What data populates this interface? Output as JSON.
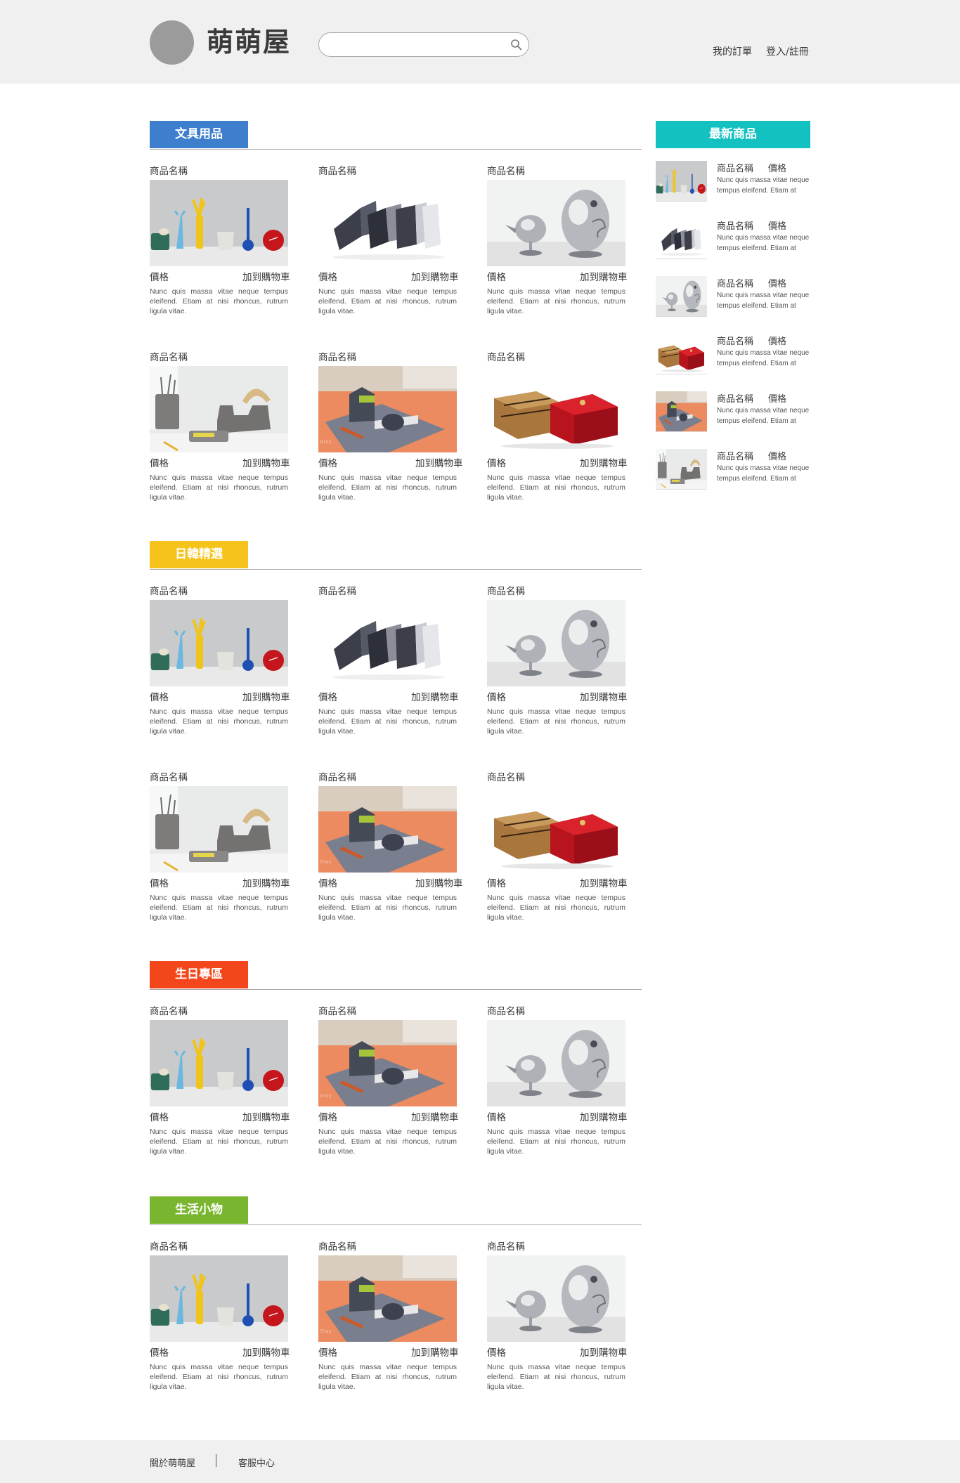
{
  "header": {
    "site_name": "萌萌屋",
    "search_placeholder": "",
    "nav": {
      "orders": "我的訂單",
      "login": "登入/註冊"
    }
  },
  "colors": {
    "stationery": "#3d7fcc",
    "japan_korea": "#f5c31c",
    "birthday": "#f4461b",
    "life": "#79b52f",
    "newest": "#13c1c1"
  },
  "product_template": {
    "name": "商品名稱",
    "price": "價格",
    "cart": "加到購物車",
    "desc": "Nunc quis massa vitae neque tempus eleifend. Etiam at nisi rhoncus, rutrum ligula vitae."
  },
  "sections": [
    {
      "title": "文具用品",
      "products": [
        {
          "image": "desk-set"
        },
        {
          "image": "tape-dispensers"
        },
        {
          "image": "chrome-birds"
        },
        {
          "image": "concrete-desk"
        },
        {
          "image": "orange-desk"
        },
        {
          "image": "gift-boxes"
        }
      ]
    },
    {
      "title": "日韓精選",
      "products": [
        {
          "image": "desk-set"
        },
        {
          "image": "tape-dispensers"
        },
        {
          "image": "chrome-birds"
        },
        {
          "image": "concrete-desk"
        },
        {
          "image": "orange-desk"
        },
        {
          "image": "gift-boxes"
        }
      ]
    },
    {
      "title": "生日專區",
      "products": [
        {
          "image": "desk-set"
        },
        {
          "image": "orange-desk"
        },
        {
          "image": "chrome-birds"
        }
      ]
    },
    {
      "title": "生活小物",
      "products": [
        {
          "image": "desk-set"
        },
        {
          "image": "orange-desk"
        },
        {
          "image": "chrome-birds"
        }
      ]
    }
  ],
  "sidebar": {
    "title": "最新商品",
    "item_name": "商品名稱",
    "item_price": "價格",
    "item_desc": "Nunc quis massa vitae neque tempus eleifend. Etiam at",
    "items": [
      {
        "image": "desk-set"
      },
      {
        "image": "tape-dispensers"
      },
      {
        "image": "chrome-birds"
      },
      {
        "image": "gift-boxes"
      },
      {
        "image": "orange-desk"
      },
      {
        "image": "concrete-desk"
      }
    ]
  },
  "footer": {
    "about": "關於萌萌屋",
    "service": "客服中心"
  }
}
